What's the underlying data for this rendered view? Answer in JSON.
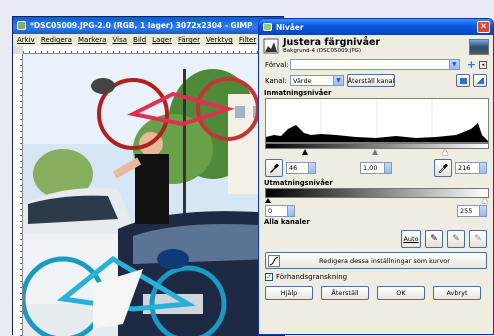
{
  "gimp": {
    "title": "*DSC05009.JPG-2.0 (RGB, 1 lager) 3072x2304 - GIMP",
    "menu": [
      "Arkiv",
      "Redigera",
      "Markera",
      "Visa",
      "Bild",
      "Lager",
      "Färger",
      "Verktyg",
      "Filter"
    ]
  },
  "dialog": {
    "title": "Nivåer",
    "heading": "Justera färgnivåer",
    "subheading": "Bakgrund-4 (DSC05009.JPG)",
    "preset_label": "Förval:",
    "preset_value": "",
    "channel_label": "Kanal:",
    "channel_value": "Värde",
    "reset_channel": "Återställ kanal",
    "input_levels": "Inmatningsnivåer",
    "input_low": "46",
    "input_gamma": "1,00",
    "input_high": "216",
    "output_levels": "Utmatningsnivåer",
    "output_low": "0",
    "output_high": "255",
    "all_channels": "Alla kanaler",
    "auto": "Auto",
    "edit_curves": "Redigera dessa inställningar som kurvor",
    "preview_label": "Förhandsgranskning",
    "preview_checked": true,
    "help": "Hjälp",
    "reset": "Återställ",
    "ok": "OK",
    "cancel": "Avbryt"
  },
  "colors": {
    "titlebar": "#0b5ae0",
    "dialog_bg": "#efece2",
    "accent_red": "#d94b2b"
  }
}
